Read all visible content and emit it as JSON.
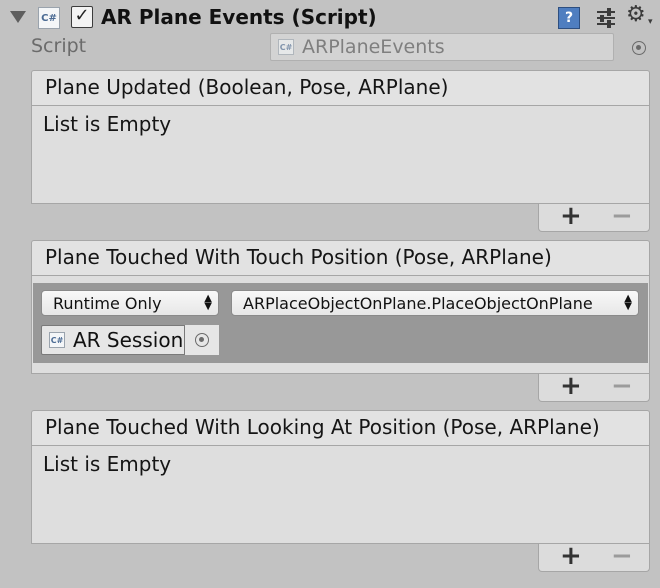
{
  "component": {
    "title": "AR Plane Events (Script)",
    "enabled": true,
    "icon": "csharp-script-icon",
    "help_icon": "?",
    "script_label": "Script",
    "script_value": "ARPlaneEvents"
  },
  "events": [
    {
      "header": "Plane Updated (Boolean, Pose, ARPlane)",
      "empty_text": "List is Empty",
      "add": "+",
      "remove": "−"
    },
    {
      "header": "Plane Touched With Touch Position (Pose, ARPlane)",
      "listener": {
        "mode": "Runtime Only",
        "function": "ARPlaceObjectOnPlane.PlaceObjectOnPlane",
        "object": "AR Session"
      },
      "add": "+",
      "remove": "−"
    },
    {
      "header": "Plane Touched With Looking At Position (Pose, ARPlane)",
      "empty_text": "List is Empty",
      "add": "+",
      "remove": "−"
    }
  ],
  "colors": {
    "background": "#c2c2c2",
    "header": "#e2e2e2",
    "listener_bg": "#989898"
  }
}
